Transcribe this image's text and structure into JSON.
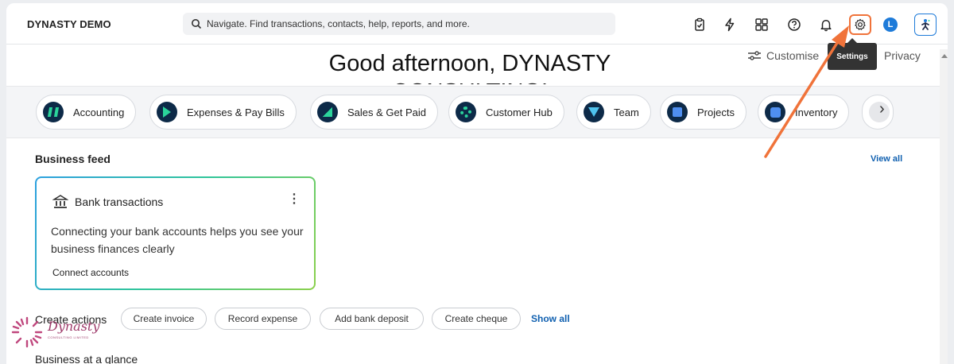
{
  "header": {
    "company": "DYNASTY DEMO",
    "search_placeholder": "Navigate. Find transactions, contacts, help, reports, and more.",
    "avatar_initial": "L",
    "tooltip": "Settings",
    "icons": [
      "task-icon",
      "bolt-icon",
      "apps-icon",
      "help-icon",
      "bell-icon",
      "gear-icon",
      "avatar",
      "assistant-icon"
    ]
  },
  "greeting": {
    "line1": "Good afternoon, DYNASTY",
    "line2": "CONSULTING!",
    "customise": "Customise",
    "privacy": "Privacy"
  },
  "nav": {
    "pills": [
      {
        "label": "Accounting",
        "icon": "accounting-icon",
        "color": "#2bd49b"
      },
      {
        "label": "Expenses & Pay Bills",
        "icon": "expenses-icon",
        "color": "#2bd49b"
      },
      {
        "label": "Sales & Get Paid",
        "icon": "sales-icon",
        "color": "#2bd49b"
      },
      {
        "label": "Customer Hub",
        "icon": "customer-hub-icon",
        "color": "#2bd49b"
      },
      {
        "label": "Team",
        "icon": "team-icon",
        "color": "#4fc3ee"
      },
      {
        "label": "Projects",
        "icon": "projects-icon",
        "color": "#4f8ff0"
      },
      {
        "label": "Inventory",
        "icon": "inventory-icon",
        "color": "#4f8ff0"
      }
    ]
  },
  "feed": {
    "title": "Business feed",
    "view_all": "View all",
    "card": {
      "title": "Bank transactions",
      "body": "Connecting your bank accounts helps you see your business finances clearly",
      "link": "Connect accounts"
    }
  },
  "create_actions": {
    "label": "Create actions",
    "buttons": [
      "Create invoice",
      "Record expense",
      "Add bank deposit",
      "Create cheque"
    ],
    "show_all": "Show all"
  },
  "glance": "Business at a glance",
  "watermark": {
    "name": "Dynasty",
    "sub": "CONSULTING LIMITED"
  },
  "colors": {
    "highlight": "#f0733a",
    "link": "#1060b0",
    "brand_dark": "#0d2a48"
  }
}
